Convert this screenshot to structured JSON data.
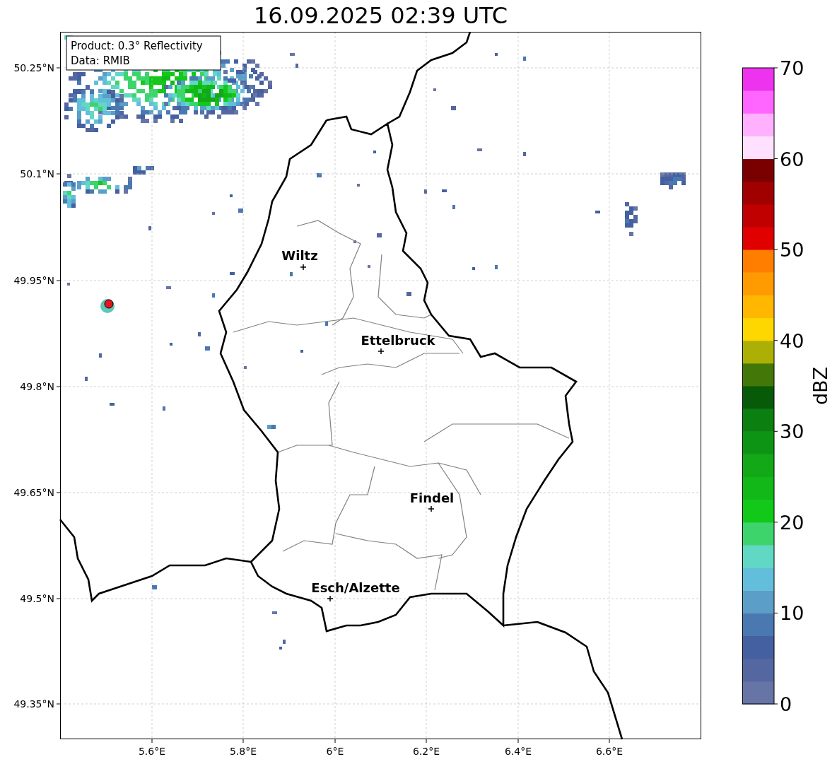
{
  "title": "16.09.2025 02:39 UTC",
  "info_box": {
    "lines": [
      "Product: 0.3° Reflectivity",
      "Data: RMIB"
    ]
  },
  "map": {
    "lat_ticks": [
      "50.25°N",
      "50.1°N",
      "49.95°N",
      "49.8°N",
      "49.65°N",
      "49.5°N",
      "49.35°N"
    ],
    "lon_ticks": [
      "5.6°E",
      "5.8°E",
      "6°E",
      "6.2°E",
      "6.4°E",
      "6.6°E"
    ],
    "cities": [
      {
        "name": "Wiltz"
      },
      {
        "name": "Ettelbruck"
      },
      {
        "name": "Findel"
      },
      {
        "name": "Esch/Alzette"
      }
    ]
  },
  "colorbar": {
    "label": "dBZ",
    "ticks": [
      "70",
      "60",
      "50",
      "40",
      "30",
      "20",
      "10",
      "0"
    ]
  }
}
